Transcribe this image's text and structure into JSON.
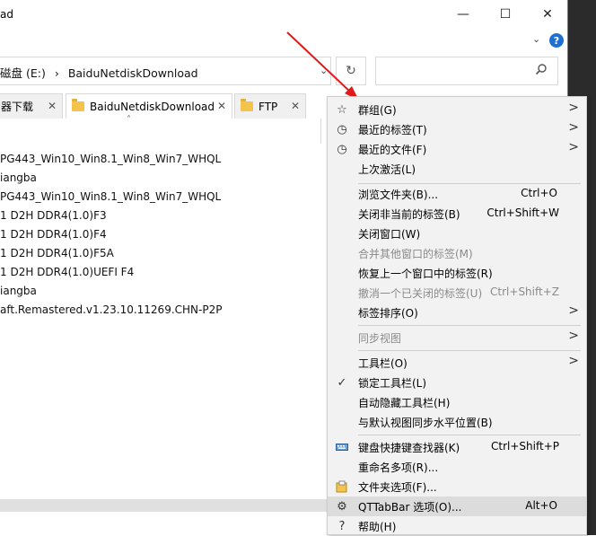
{
  "window": {
    "title_fragment": "ad",
    "minimize": "—",
    "maximize": "☐",
    "close": "✕",
    "help": "?",
    "ribbon_chevron": "⌄"
  },
  "address": {
    "drive": "磁盘 (E:)",
    "separator": "›",
    "folder": "BaiduNetdiskDownload",
    "dropdown": "⌄",
    "refresh": "↻"
  },
  "search": {
    "placeholder": "",
    "icon": "search-icon"
  },
  "tabs": [
    {
      "label": "器下载",
      "close": "✕"
    },
    {
      "label": "BaiduNetdiskDownload",
      "close": "✕"
    },
    {
      "label": "FTP",
      "close": "✕"
    }
  ],
  "tab_caret": "˄",
  "files": [
    "PG443_Win10_Win8.1_Win8_Win7_WHQL",
    "iangba",
    "PG443_Win10_Win8.1_Win8_Win7_WHQL",
    "1 D2H DDR4(1.0)F3",
    "1 D2H DDR4(1.0)F4",
    "1 D2H DDR4(1.0)F5A",
    "1 D2H DDR4(1.0)UEFI F4",
    "iangba",
    "aft.Remastered.v1.23.10.11269.CHN-P2P"
  ],
  "menu": {
    "items": [
      {
        "label": "群组(G)",
        "shortcut": "",
        "submenu": true,
        "icon": "star-icon",
        "disabled": false
      },
      {
        "label": "最近的标签(T)",
        "shortcut": "",
        "submenu": true,
        "icon": "recent-tabs-icon",
        "disabled": false
      },
      {
        "label": "最近的文件(F)",
        "shortcut": "",
        "submenu": true,
        "icon": "recent-files-icon",
        "disabled": false
      },
      {
        "label": "上次激活(L)",
        "shortcut": "",
        "submenu": false,
        "icon": "",
        "disabled": false
      },
      {
        "label": "浏览文件夹(B)...",
        "shortcut": "Ctrl+O",
        "submenu": false,
        "icon": "",
        "disabled": false
      },
      {
        "label": "关闭非当前的标签(B)",
        "shortcut": "Ctrl+Shift+W",
        "submenu": false,
        "icon": "",
        "disabled": false
      },
      {
        "label": "关闭窗口(W)",
        "shortcut": "",
        "submenu": false,
        "icon": "",
        "disabled": false
      },
      {
        "label": "合并其他窗口的标签(M)",
        "shortcut": "",
        "submenu": false,
        "icon": "",
        "disabled": true
      },
      {
        "label": "恢复上一个窗口中的标签(R)",
        "shortcut": "",
        "submenu": false,
        "icon": "",
        "disabled": false
      },
      {
        "label": "撤消一个已关闭的标签(U)",
        "shortcut": "Ctrl+Shift+Z",
        "submenu": false,
        "icon": "",
        "disabled": true
      },
      {
        "label": "标签排序(O)",
        "shortcut": "",
        "submenu": true,
        "icon": "",
        "disabled": false
      },
      {
        "label": "同步视图",
        "shortcut": "",
        "submenu": true,
        "icon": "",
        "disabled": true
      },
      {
        "label": "工具栏(O)",
        "shortcut": "",
        "submenu": true,
        "icon": "",
        "disabled": false
      },
      {
        "label": "锁定工具栏(L)",
        "shortcut": "",
        "submenu": false,
        "icon": "check-icon",
        "disabled": false
      },
      {
        "label": "自动隐藏工具栏(H)",
        "shortcut": "",
        "submenu": false,
        "icon": "",
        "disabled": false
      },
      {
        "label": "与默认视图同步水平位置(B)",
        "shortcut": "",
        "submenu": false,
        "icon": "",
        "disabled": false
      },
      {
        "label": "键盘快捷键查找器(K)",
        "shortcut": "Ctrl+Shift+P",
        "submenu": false,
        "icon": "keyboard-icon",
        "disabled": false
      },
      {
        "label": "重命名多项(R)...",
        "shortcut": "",
        "submenu": false,
        "icon": "",
        "disabled": false
      },
      {
        "label": "文件夹选项(F)...",
        "shortcut": "",
        "submenu": false,
        "icon": "folder-options-icon",
        "disabled": false
      },
      {
        "label": "QTTabBar 选项(O)...",
        "shortcut": "Alt+O",
        "submenu": false,
        "icon": "gear-icon",
        "disabled": false,
        "highlighted": true
      },
      {
        "label": "帮助(H)",
        "shortcut": "",
        "submenu": false,
        "icon": "help-icon",
        "disabled": false
      }
    ],
    "submenu_glyph": ">"
  },
  "colors": {
    "menu_bg": "#f2f2f2",
    "highlight": "#dcdcdc",
    "arrow": "#e0191b",
    "folder": "#f3c44b",
    "help_blue": "#1f6fd1"
  }
}
